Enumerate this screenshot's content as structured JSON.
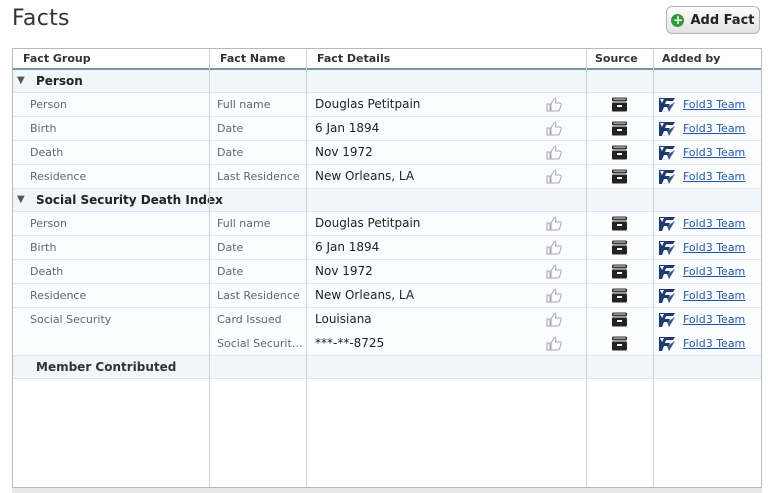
{
  "page": {
    "title": "Facts",
    "add_button_label": "Add Fact"
  },
  "table": {
    "headers": [
      "Fact Group",
      "Fact Name",
      "Fact Details",
      "Source",
      "Added by"
    ],
    "groups": [
      {
        "name": "Person",
        "rows": [
          {
            "group": "Person",
            "name": "Full name",
            "detail": "Douglas Petitpain",
            "added_by": "Fold3 Team"
          },
          {
            "group": "Birth",
            "name": "Date",
            "detail": "6 Jan 1894",
            "added_by": "Fold3 Team"
          },
          {
            "group": "Death",
            "name": "Date",
            "detail": "Nov 1972",
            "added_by": "Fold3 Team"
          },
          {
            "group": "Residence",
            "name": "Last Residence",
            "detail": "New Orleans, LA",
            "added_by": "Fold3 Team"
          }
        ]
      },
      {
        "name": "Social Security Death Index",
        "rows": [
          {
            "group": "Person",
            "name": "Full name",
            "detail": "Douglas Petitpain",
            "added_by": "Fold3 Team"
          },
          {
            "group": "Birth",
            "name": "Date",
            "detail": "6 Jan 1894",
            "added_by": "Fold3 Team"
          },
          {
            "group": "Death",
            "name": "Date",
            "detail": "Nov 1972",
            "added_by": "Fold3 Team"
          },
          {
            "group": "Residence",
            "name": "Last Residence",
            "detail": "New Orleans, LA",
            "added_by": "Fold3 Team"
          },
          {
            "group": "Social Security",
            "name": "Card Issued",
            "detail": "Louisiana",
            "added_by": "Fold3 Team"
          },
          {
            "group": "",
            "name": "Social Security...",
            "detail": "***-**-8725",
            "added_by": "Fold3 Team"
          }
        ]
      }
    ],
    "member_section": "Member Contributed"
  },
  "icons": {
    "add": "plus-circle-icon",
    "collapse": "triangle-down-icon",
    "like": "thumbs-up-icon",
    "source": "file-drawer-icon",
    "added_by": "fold3-logo-icon"
  },
  "colors": {
    "link": "#2357a5",
    "group_bg": "#f0f6fb",
    "header_rule": "#7a9aa8",
    "add_icon": "#2e9a39"
  }
}
